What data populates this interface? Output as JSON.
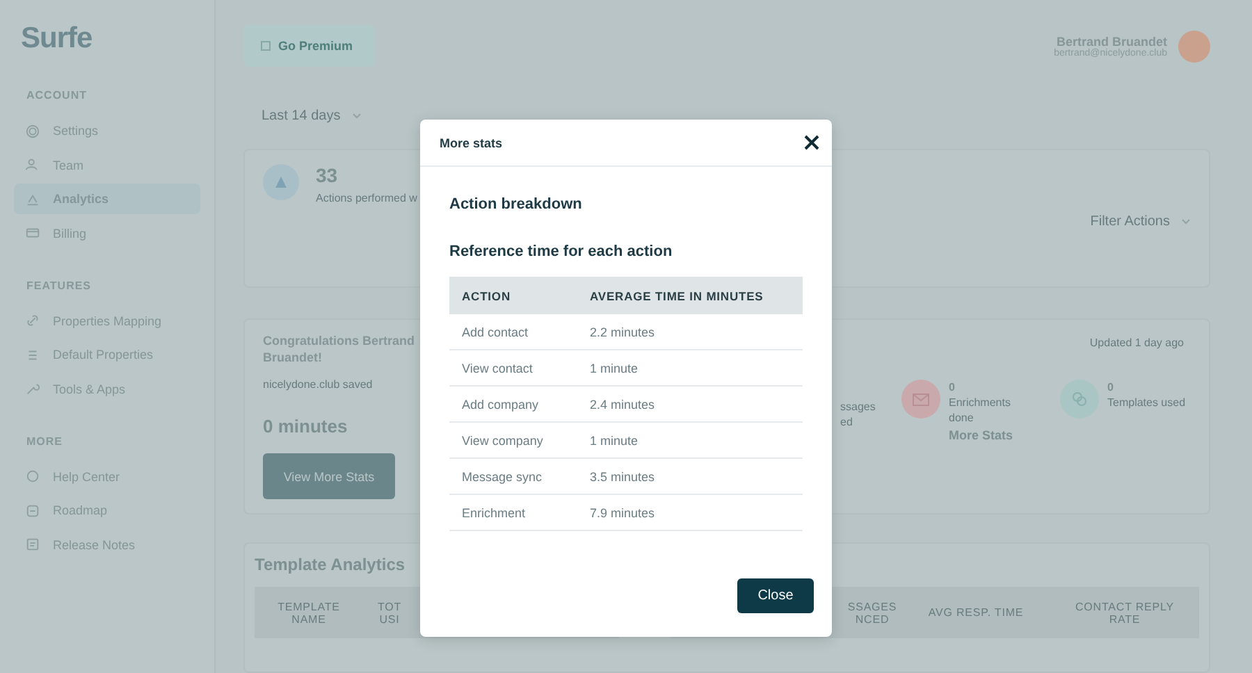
{
  "sidebar": {
    "logo": "Surfe",
    "sections": [
      {
        "title": "ACCOUNT",
        "items": [
          {
            "label": "Settings",
            "selected": false
          },
          {
            "label": "Team",
            "selected": false
          },
          {
            "label": "Analytics",
            "selected": true
          },
          {
            "label": "Billing",
            "selected": false
          }
        ]
      },
      {
        "title": "FEATURES",
        "items": [
          {
            "label": "Properties Mapping",
            "selected": false
          },
          {
            "label": "Default Properties",
            "selected": false
          },
          {
            "label": "Tools & Apps",
            "selected": false
          }
        ]
      },
      {
        "title": "MORE",
        "items": [
          {
            "label": "Help Center",
            "selected": false
          },
          {
            "label": "Roadmap",
            "selected": false
          },
          {
            "label": "Release Notes",
            "selected": false
          }
        ]
      }
    ]
  },
  "header": {
    "premium_button": "Go Premium",
    "user": {
      "name": "Bertrand Bruandet",
      "email": "bertrand@nicelydone.club"
    }
  },
  "period_select": "Last 14 days",
  "actions_card": {
    "count": "33",
    "caption": "Actions performed w",
    "filter": "Filter Actions"
  },
  "savings_card": {
    "title": "Congratulations Bertrand Bruandet!",
    "subtitle": "nicelydone.club saved",
    "amount": "0 minutes",
    "button": "View More Stats",
    "updated": "Updated 1 day ago",
    "stats": [
      {
        "kind": "partial",
        "lines": [
          "ssages",
          "ed"
        ]
      },
      {
        "kind": "enrichments",
        "value": "0",
        "label": "Enrichments done",
        "link": "More Stats",
        "color": "#c9a9ac"
      },
      {
        "kind": "templates",
        "value": "0",
        "label": "Templates used",
        "color": "#a9c6c4"
      }
    ]
  },
  "template_analytics": {
    "title": "Template Analytics",
    "left_columns": [
      "TEMPLATE NAME",
      "TOT USI"
    ],
    "right_columns": [
      "SSAGES NCED",
      "AVG RESP. TIME",
      "CONTACT REPLY RATE"
    ]
  },
  "modal": {
    "title": "More stats",
    "heading": "Action breakdown",
    "subheading": "Reference time for each action",
    "columns": [
      "ACTION",
      "AVERAGE TIME IN MINUTES"
    ],
    "rows": [
      [
        "Add contact",
        "2.2 minutes"
      ],
      [
        "View contact",
        "1 minute"
      ],
      [
        "Add company",
        "2.4 minutes"
      ],
      [
        "View company",
        "1 minute"
      ],
      [
        "Message sync",
        "3.5 minutes"
      ],
      [
        "Enrichment",
        "7.9 minutes"
      ]
    ],
    "close_button": "Close"
  }
}
